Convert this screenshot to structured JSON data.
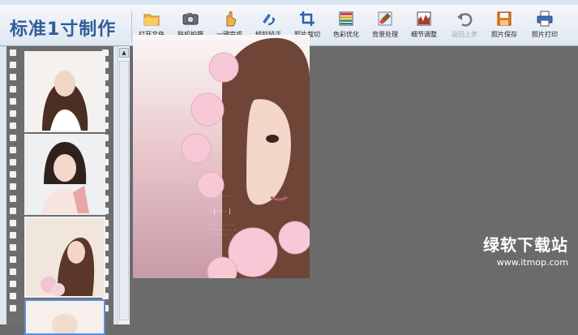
{
  "app": {
    "title": "标准1寸制作"
  },
  "toolbar": {
    "buttons": [
      {
        "id": "open",
        "label": "打开文件",
        "icon": "folder-icon",
        "enabled": true
      },
      {
        "id": "camera",
        "label": "联机拍摄",
        "icon": "camera-icon",
        "enabled": true
      },
      {
        "id": "oneclick",
        "label": "一键完成",
        "icon": "hand-icon",
        "enabled": true
      },
      {
        "id": "tilt",
        "label": "倾斜矫正",
        "icon": "tilt-icon",
        "enabled": true
      },
      {
        "id": "crop",
        "label": "照片裁切",
        "icon": "crop-icon",
        "enabled": true
      },
      {
        "id": "color",
        "label": "色彩优化",
        "icon": "palette-icon",
        "enabled": true
      },
      {
        "id": "bg",
        "label": "背景处理",
        "icon": "brush-icon",
        "enabled": true
      },
      {
        "id": "detail",
        "label": "细节调整",
        "icon": "levels-icon",
        "enabled": true
      },
      {
        "id": "undo",
        "label": "返回上步",
        "icon": "undo-icon",
        "enabled": false
      },
      {
        "id": "save",
        "label": "照片保存",
        "icon": "save-icon",
        "enabled": true
      },
      {
        "id": "print",
        "label": "照片打印",
        "icon": "printer-icon",
        "enabled": true
      }
    ]
  },
  "filmstrip": {
    "thumbnails": [
      {
        "name": "photo-1",
        "selected": false
      },
      {
        "name": "photo-2",
        "selected": false
      },
      {
        "name": "photo-3",
        "selected": false
      },
      {
        "name": "photo-4",
        "selected": true
      }
    ]
  },
  "watermark": {
    "site_name": "绿软下载站",
    "url": "www.itmop.com"
  },
  "colors": {
    "accent": "#2f5d97",
    "canvas": "#6b6b6b",
    "film": "#6d6d6d",
    "selected": "#5b8fd8"
  }
}
